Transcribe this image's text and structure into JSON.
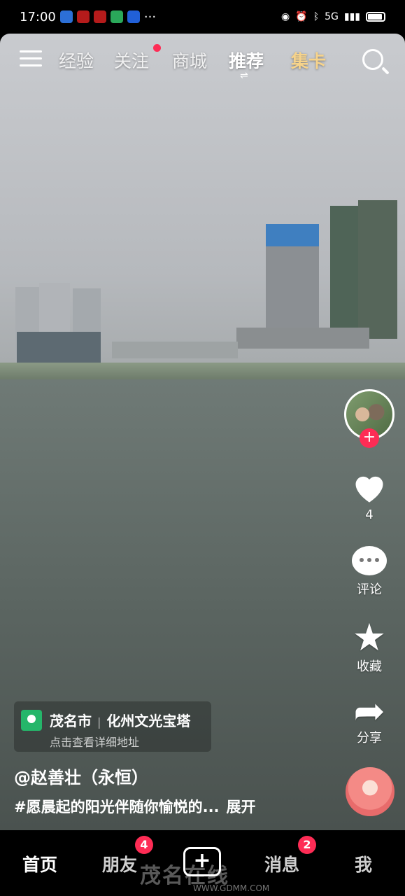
{
  "status_bar": {
    "time": "17:00",
    "more": "···",
    "network": "5G"
  },
  "top_nav": {
    "tabs": [
      {
        "label": "经验"
      },
      {
        "label": "关注"
      },
      {
        "label": "商城"
      },
      {
        "label": "推荐"
      },
      {
        "label": "集卡"
      }
    ],
    "active_tab": "推荐",
    "highlight_color": "#f6d38b"
  },
  "right_rail": {
    "likes": "4",
    "comment_label": "评论",
    "favorite_label": "收藏",
    "share_label": "分享",
    "follow_symbol": "+"
  },
  "location": {
    "city": "茂名市",
    "separator": "|",
    "place": "化州文光宝塔",
    "subtitle": "点击查看详细地址"
  },
  "author": "@赵善壮（永恒）",
  "caption": {
    "text": "#愿晨起的阳光伴随你愉悦的...",
    "expand": "展开"
  },
  "bottom_nav": {
    "home": "首页",
    "friends": "朋友",
    "friends_badge": "4",
    "create": "+",
    "messages": "消息",
    "messages_badge": "2",
    "me": "我"
  },
  "watermark": {
    "text": "茂名在线",
    "url": "WWW.GDMM.COM"
  },
  "colors": {
    "accent": "#fe2c55",
    "location_pin": "#25b66a"
  }
}
